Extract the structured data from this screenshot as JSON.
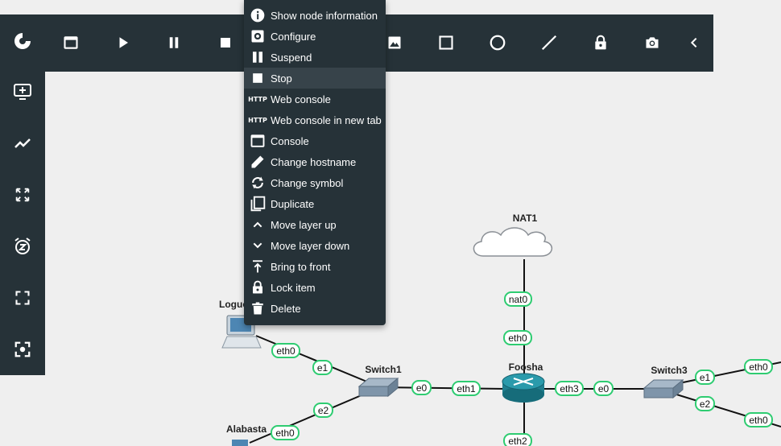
{
  "left_toolbar": {
    "items": [
      {
        "name": "gns3-logo-button",
        "icon": "gns3-chameleon-icon"
      },
      {
        "name": "add-device-button",
        "icon": "add-screen-icon"
      },
      {
        "name": "add-link-button",
        "icon": "link-line-icon"
      },
      {
        "name": "fit-to-screen-button",
        "icon": "fit-arrows-icon"
      },
      {
        "name": "snooze-button",
        "icon": "snooze-alarm-icon"
      },
      {
        "name": "fullscreen-button",
        "icon": "fullscreen-icon"
      },
      {
        "name": "center-view-button",
        "icon": "center-focus-icon"
      }
    ]
  },
  "top_toolbar": {
    "items": [
      {
        "name": "console-all-button",
        "icon": "window-icon"
      },
      {
        "name": "start-all-button",
        "icon": "play-icon"
      },
      {
        "name": "suspend-all-button",
        "icon": "pause-icon"
      },
      {
        "name": "stop-all-button",
        "icon": "stop-icon"
      },
      {
        "name": "insert-image-button",
        "icon": "image-icon"
      },
      {
        "name": "draw-rectangle-button",
        "icon": "rectangle-icon"
      },
      {
        "name": "draw-ellipse-button",
        "icon": "circle-icon"
      },
      {
        "name": "draw-line-button",
        "icon": "line-icon"
      },
      {
        "name": "lock-all-button",
        "icon": "lock-icon"
      },
      {
        "name": "screenshot-button",
        "icon": "camera-icon"
      },
      {
        "name": "collapse-toolbar-button",
        "icon": "chevron-left-icon"
      }
    ]
  },
  "context_menu": {
    "items": [
      {
        "label": "Show node information",
        "icon": "info-icon"
      },
      {
        "label": "Configure",
        "icon": "gear-icon"
      },
      {
        "label": "Suspend",
        "icon": "pause-icon"
      },
      {
        "label": "Stop",
        "icon": "stop-icon",
        "active": true
      },
      {
        "label": "Web console",
        "icon": "http-icon"
      },
      {
        "label": "Web console in new tab",
        "icon": "http-icon"
      },
      {
        "label": "Console",
        "icon": "window-icon"
      },
      {
        "label": "Change hostname",
        "icon": "pencil-icon"
      },
      {
        "label": "Change symbol",
        "icon": "sync-icon"
      },
      {
        "label": "Duplicate",
        "icon": "copy-icon"
      },
      {
        "label": "Move layer up",
        "icon": "chevron-up-icon"
      },
      {
        "label": "Move layer down",
        "icon": "chevron-down-icon"
      },
      {
        "label": "Bring to front",
        "icon": "bring-front-icon"
      },
      {
        "label": "Lock item",
        "icon": "lock-icon"
      },
      {
        "label": "Delete",
        "icon": "trash-icon"
      }
    ]
  },
  "topology": {
    "nodes": {
      "nat1": "NAT1",
      "logue": "Logue",
      "switch1": "Switch1",
      "foosha": "Foosha",
      "switch3": "Switch3",
      "alabasta": "Alabasta"
    },
    "ports": {
      "nat0": "nat0",
      "foosha_eth0": "eth0",
      "logue_eth0": "eth0",
      "switch1_e1": "e1",
      "switch1_e0": "e0",
      "foosha_eth1": "eth1",
      "foosha_eth3": "eth3",
      "switch3_e0": "e0",
      "switch3_e1": "e1",
      "switch3_e2": "e2",
      "right_top_eth0": "eth0",
      "right_bottom_eth0": "eth0",
      "switch1_e2": "e2",
      "alabasta_eth0": "eth0",
      "foosha_eth2": "eth2"
    }
  },
  "colors": {
    "toolbar_bg": "#263238",
    "canvas_bg": "#efefef",
    "port_border": "#2ecc71",
    "menu_hover": "#37434a"
  }
}
